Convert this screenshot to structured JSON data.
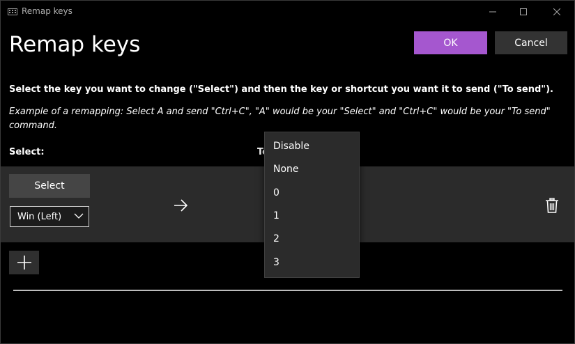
{
  "window": {
    "title": "Remap keys",
    "app_icon": "keyboard-icon"
  },
  "header": {
    "title": "Remap keys",
    "ok_label": "OK",
    "cancel_label": "Cancel"
  },
  "instructions": {
    "main": "Select the key you want to change (\"Select\") and then the key or shortcut you want it to send (\"To send\").",
    "example": "Example of a remapping: Select A and send \"Ctrl+C\", \"A\" would be your \"Select\" and \"Ctrl+C\" would be your \"To send\" command."
  },
  "columns": {
    "select": "Select:",
    "to_send": "To send:"
  },
  "mapping": {
    "select_button": "Select",
    "selected_key": "Win (Left)",
    "arrow_icon": "arrow-right-icon",
    "delete_icon": "trash-icon"
  },
  "add_icon": "plus-icon",
  "dropdown": {
    "options": [
      "Disable",
      "None",
      "0",
      "1",
      "2",
      "3"
    ]
  },
  "colors": {
    "accent": "#a557cf",
    "row_background": "#2b2b2b",
    "background": "#000000"
  }
}
